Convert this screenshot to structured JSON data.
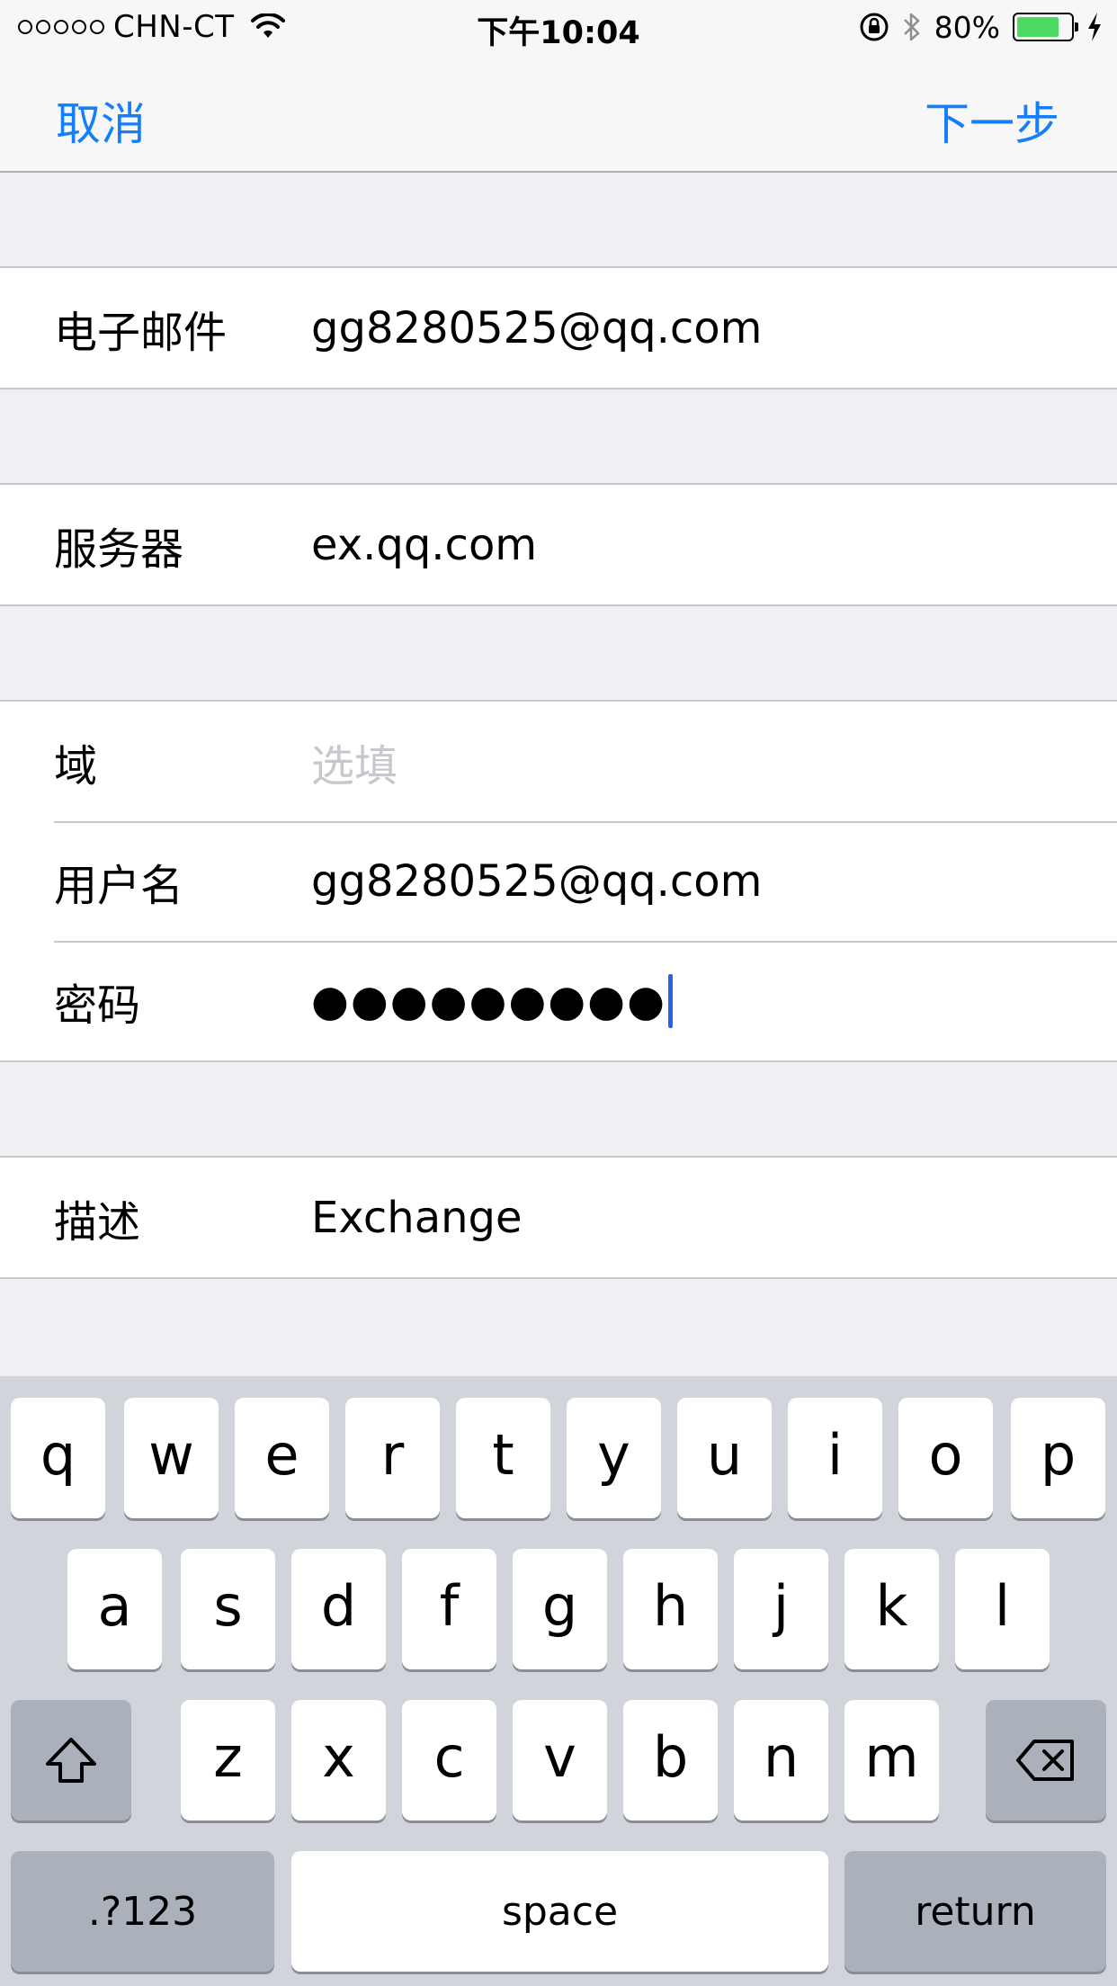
{
  "status_bar": {
    "carrier": "CHN-CT",
    "time": "下午10:04",
    "battery_percent": "80%",
    "battery_level": 0.8,
    "signal_bars_filled": 0,
    "icons": [
      "wifi-icon",
      "rotation-lock-icon",
      "bluetooth-icon",
      "battery-icon",
      "charging-icon"
    ]
  },
  "nav": {
    "cancel_label": "取消",
    "next_label": "下一步",
    "accent_color": "#147efb"
  },
  "form": {
    "email": {
      "label": "电子邮件",
      "value": "gg8280525@qq.com"
    },
    "server": {
      "label": "服务器",
      "value": "ex.qq.com"
    },
    "domain": {
      "label": "域",
      "placeholder": "选填",
      "value": ""
    },
    "username": {
      "label": "用户名",
      "value": "gg8280525@qq.com"
    },
    "password": {
      "label": "密码",
      "masked_value": "●●●●●●●●●"
    },
    "description": {
      "label": "描述",
      "value": "Exchange"
    }
  },
  "keyboard": {
    "row1": [
      "q",
      "w",
      "e",
      "r",
      "t",
      "y",
      "u",
      "i",
      "o",
      "p"
    ],
    "row2": [
      "a",
      "s",
      "d",
      "f",
      "g",
      "h",
      "j",
      "k",
      "l"
    ],
    "row3": [
      "z",
      "x",
      "c",
      "v",
      "b",
      "n",
      "m"
    ],
    "numbers_label": ".?123",
    "space_label": "space",
    "return_label": "return",
    "icons": [
      "shift-icon",
      "backspace-icon"
    ]
  }
}
